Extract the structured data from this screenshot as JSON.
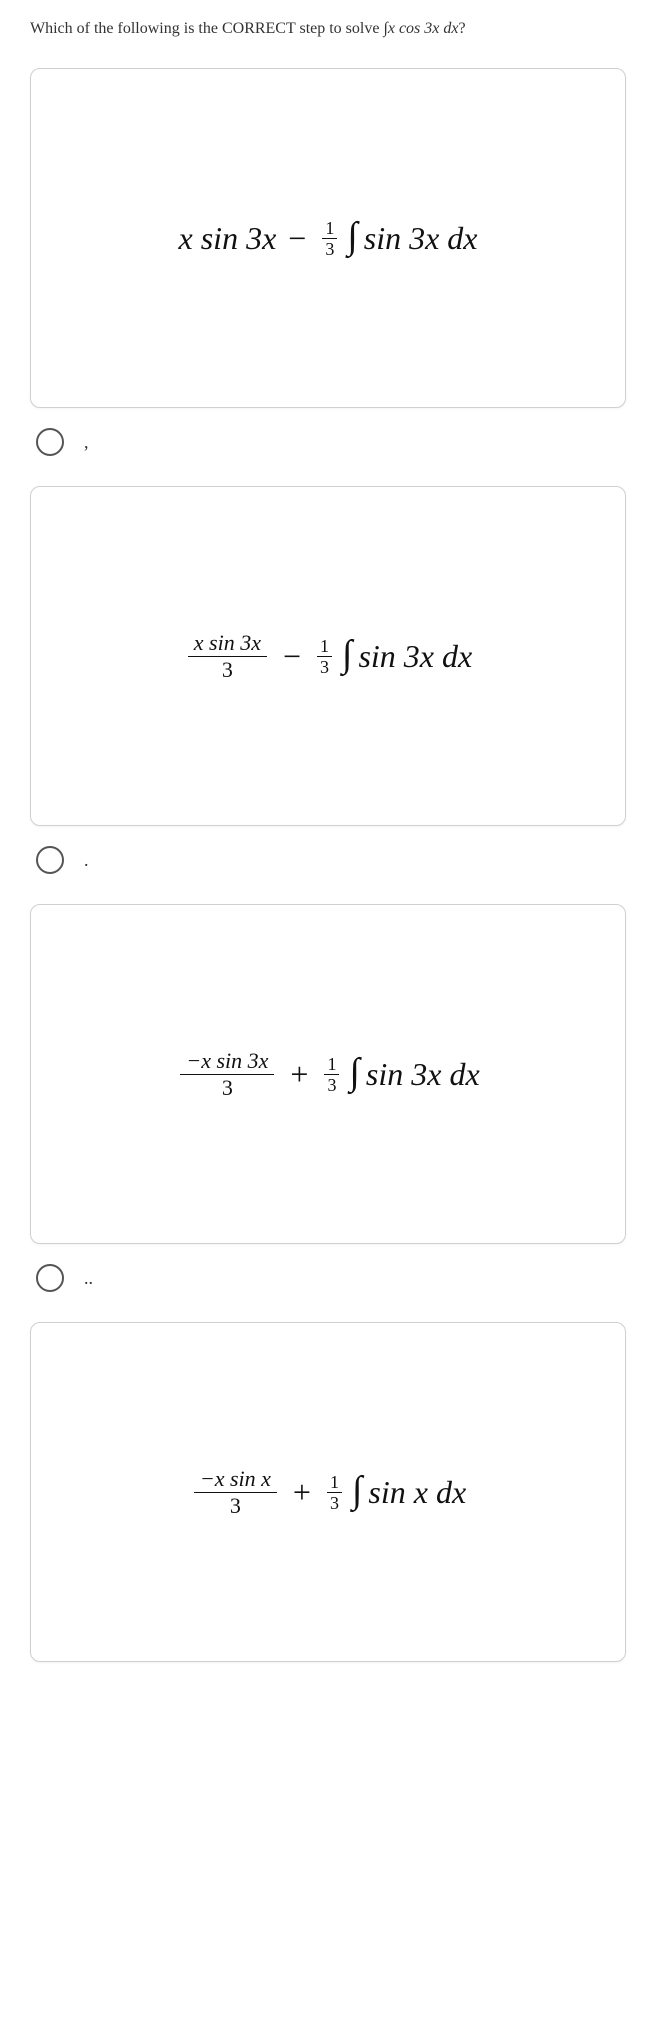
{
  "question": {
    "prefix": "Which of the following is the CORRECT step to solve ",
    "integral_expr": "∫x cos 3x dx",
    "suffix": "?"
  },
  "options": [
    {
      "type": "plain",
      "lhs_num": "",
      "lhs_den": "",
      "plain_lhs": "x sin 3x",
      "sign": "−",
      "coef_num": "1",
      "coef_den": "3",
      "int_body": "sin 3x dx",
      "label": ","
    },
    {
      "type": "frac",
      "lhs_num": "x sin 3x",
      "lhs_den": "3",
      "plain_lhs": "",
      "sign": "−",
      "coef_num": "1",
      "coef_den": "3",
      "int_body": "sin 3x dx",
      "label": "."
    },
    {
      "type": "frac",
      "lhs_num": "−x sin 3x",
      "lhs_den": "3",
      "plain_lhs": "",
      "sign": "+",
      "coef_num": "1",
      "coef_den": "3",
      "int_body": "sin 3x dx",
      "label": ".."
    },
    {
      "type": "frac",
      "lhs_num": "−x sin x",
      "lhs_den": "3",
      "plain_lhs": "",
      "sign": "+",
      "coef_num": "1",
      "coef_den": "3",
      "int_body": "sin x dx",
      "label": ""
    }
  ]
}
